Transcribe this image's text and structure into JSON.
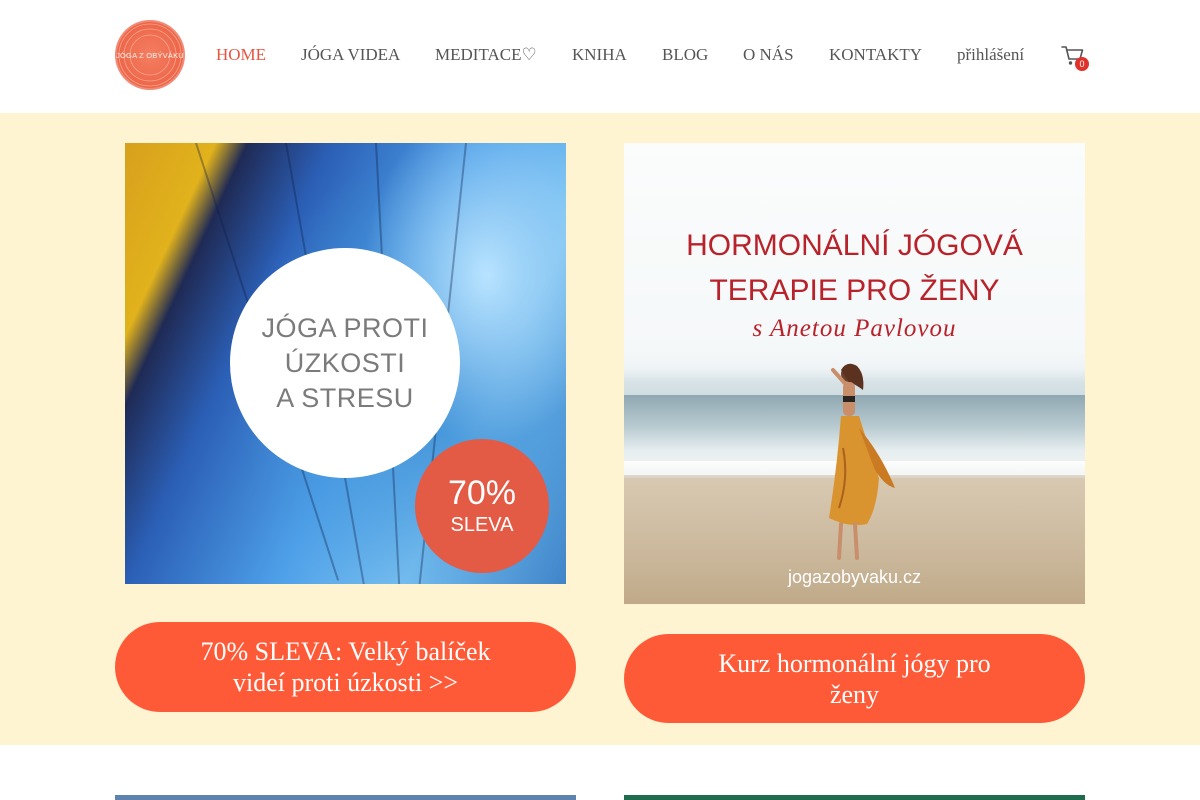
{
  "header": {
    "logo_text": "JÓGA Z OBÝVÁKU",
    "nav": [
      {
        "label": "HOME",
        "active": true
      },
      {
        "label": "JÓGA VIDEA",
        "active": false
      },
      {
        "label": "MEDITACE♡",
        "active": false
      },
      {
        "label": "KNIHA",
        "active": false
      },
      {
        "label": "BLOG",
        "active": false
      },
      {
        "label": "O NÁS",
        "active": false
      },
      {
        "label": "KONTAKTY",
        "active": false
      },
      {
        "label": "přihlášení",
        "active": false
      }
    ],
    "cart_count": "0",
    "cart_icon": "shopping-cart-icon"
  },
  "promo": {
    "left_card": {
      "circle_lines": [
        "JÓGA PROTI",
        "ÚZKOSTI",
        "A STRESU"
      ],
      "sale_percent": "70%",
      "sale_word": "SLEVA",
      "cta_line1": "70% SLEVA: Velký balíček",
      "cta_line2": "videí proti úzkosti >>"
    },
    "right_card": {
      "title_line1": "HORMONÁLNÍ JÓGOVÁ",
      "title_line2": "TERAPIE PRO ŽENY",
      "subtitle": "s Anetou Pavlovou",
      "url": "jogazobyvaku.cz",
      "cta_line1": "Kurz hormonální jógy pro",
      "cta_line2": "ženy"
    }
  },
  "colors": {
    "accent": "#ff5a38",
    "nav_active": "#e8553f",
    "promo_bg": "#fff4d2",
    "title_red": "#b8232b"
  }
}
